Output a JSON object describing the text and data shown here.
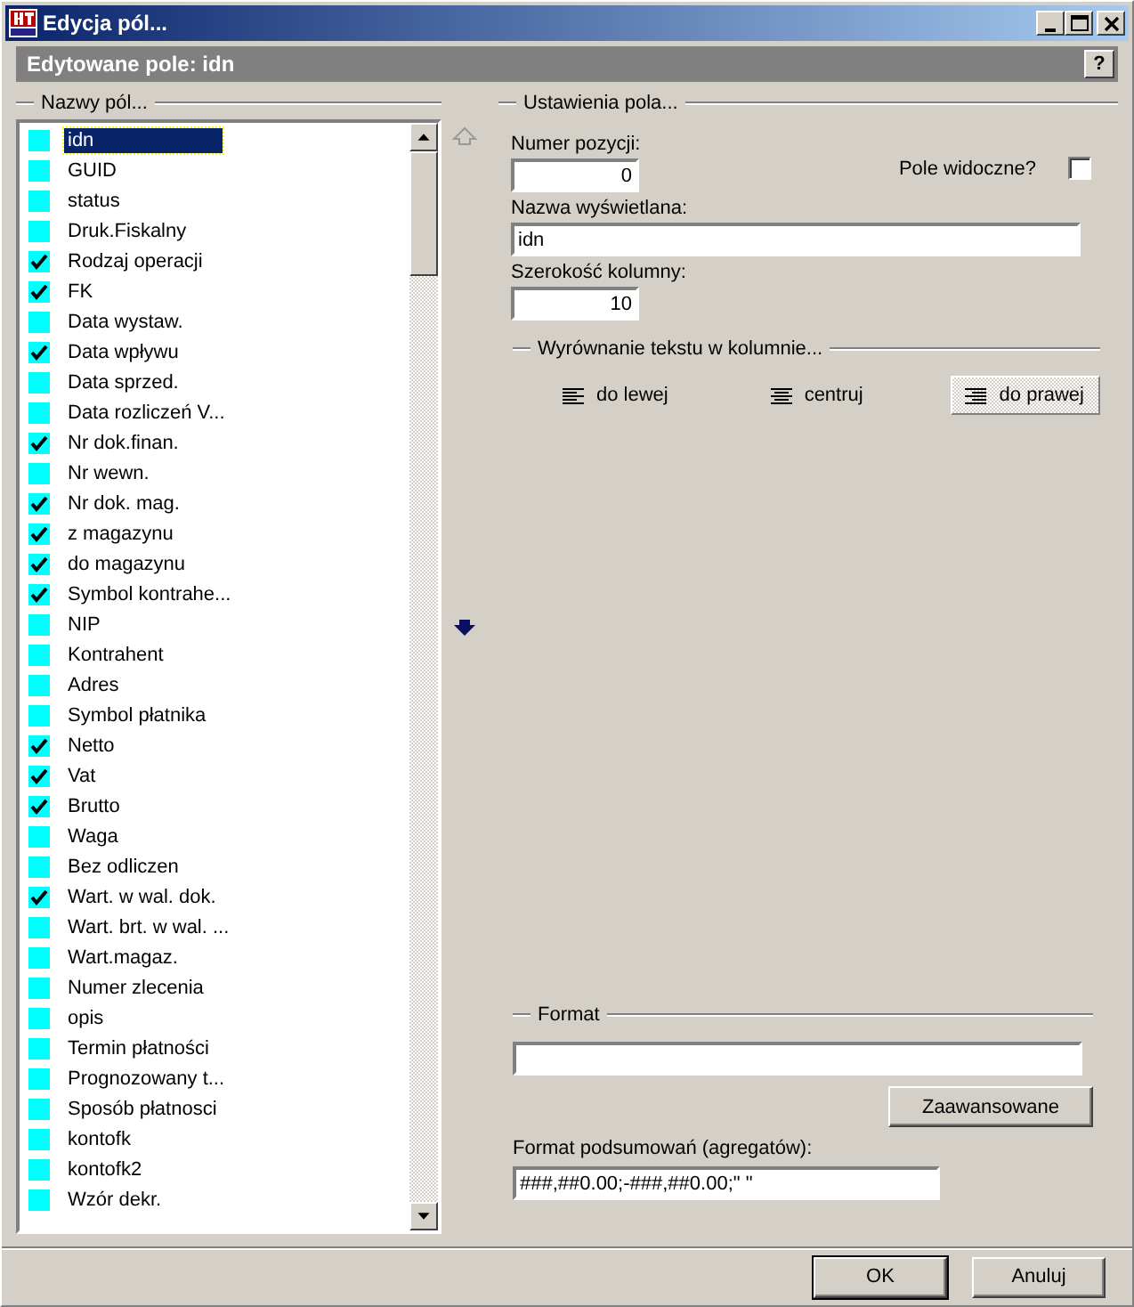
{
  "window": {
    "title": "Edycja pól..."
  },
  "header": {
    "title": "Edytowane pole: idn",
    "help": "?"
  },
  "fields_group": {
    "title": "Nazwy pól...",
    "items": [
      {
        "label": "idn",
        "checked": false,
        "selected": true
      },
      {
        "label": "GUID",
        "checked": false,
        "selected": false
      },
      {
        "label": "status",
        "checked": false,
        "selected": false
      },
      {
        "label": "Druk.Fiskalny",
        "checked": false,
        "selected": false
      },
      {
        "label": "Rodzaj operacji",
        "checked": true,
        "selected": false
      },
      {
        "label": "FK",
        "checked": true,
        "selected": false
      },
      {
        "label": "Data wystaw.",
        "checked": false,
        "selected": false
      },
      {
        "label": "Data wpływu",
        "checked": true,
        "selected": false
      },
      {
        "label": "Data sprzed.",
        "checked": false,
        "selected": false
      },
      {
        "label": "Data rozliczeń V...",
        "checked": false,
        "selected": false
      },
      {
        "label": "Nr dok.finan.",
        "checked": true,
        "selected": false
      },
      {
        "label": "Nr wewn.",
        "checked": false,
        "selected": false
      },
      {
        "label": "Nr dok. mag.",
        "checked": true,
        "selected": false
      },
      {
        "label": "z magazynu",
        "checked": true,
        "selected": false
      },
      {
        "label": "do magazynu",
        "checked": true,
        "selected": false
      },
      {
        "label": "Symbol kontrahe...",
        "checked": true,
        "selected": false
      },
      {
        "label": "NIP",
        "checked": false,
        "selected": false
      },
      {
        "label": "Kontrahent",
        "checked": false,
        "selected": false
      },
      {
        "label": "Adres",
        "checked": false,
        "selected": false
      },
      {
        "label": "Symbol płatnika",
        "checked": false,
        "selected": false
      },
      {
        "label": "Netto",
        "checked": true,
        "selected": false
      },
      {
        "label": "Vat",
        "checked": true,
        "selected": false
      },
      {
        "label": "Brutto",
        "checked": true,
        "selected": false
      },
      {
        "label": "Waga",
        "checked": false,
        "selected": false
      },
      {
        "label": "Bez odliczen",
        "checked": false,
        "selected": false
      },
      {
        "label": "Wart. w wal. dok.",
        "checked": true,
        "selected": false
      },
      {
        "label": "Wart. brt. w wal. ...",
        "checked": false,
        "selected": false
      },
      {
        "label": "Wart.magaz.",
        "checked": false,
        "selected": false
      },
      {
        "label": "Numer zlecenia",
        "checked": false,
        "selected": false
      },
      {
        "label": "opis",
        "checked": false,
        "selected": false
      },
      {
        "label": "Termin płatności",
        "checked": false,
        "selected": false
      },
      {
        "label": "Prognozowany t...",
        "checked": false,
        "selected": false
      },
      {
        "label": "Sposób płatnosci",
        "checked": false,
        "selected": false
      },
      {
        "label": "kontofk",
        "checked": false,
        "selected": false
      },
      {
        "label": "kontofk2",
        "checked": false,
        "selected": false
      },
      {
        "label": "Wzór dekr.",
        "checked": false,
        "selected": false
      }
    ]
  },
  "settings_group": {
    "title": "Ustawienia pola...",
    "position": {
      "label": "Numer pozycji:",
      "value": "0"
    },
    "visible": {
      "label": "Pole widoczne?",
      "checked": false
    },
    "display_name": {
      "label": "Nazwa wyświetlana:",
      "value": "idn"
    },
    "column_width": {
      "label": "Szerokość kolumny:",
      "value": "10"
    },
    "alignment": {
      "title": "Wyrównanie tekstu w kolumnie...",
      "options": [
        {
          "label": "do lewej",
          "kind": "left",
          "selected": false
        },
        {
          "label": "centruj",
          "kind": "center",
          "selected": false
        },
        {
          "label": "do prawej",
          "kind": "right",
          "selected": true
        }
      ]
    }
  },
  "format_group": {
    "title": "Format",
    "advanced_button": "Zaawansowane",
    "summary": {
      "label": "Format podsumowań (agregatów):",
      "value": "###,##0.00;-###,##0.00;\" \""
    }
  },
  "buttons": [
    "OK",
    "Anuluj"
  ]
}
